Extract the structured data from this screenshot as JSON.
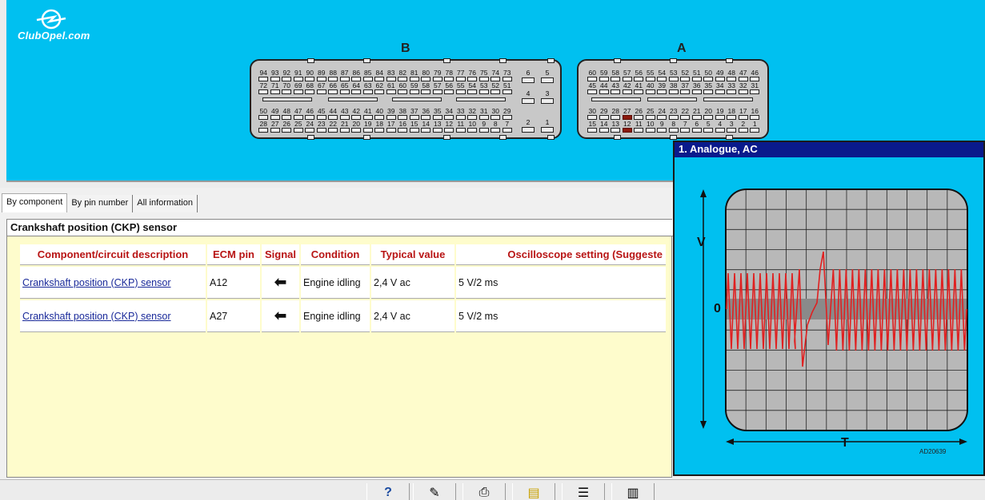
{
  "brand": {
    "logo_text": "ClubOpel.com"
  },
  "connectors": {
    "b": {
      "label": "B",
      "rows": [
        [
          "94",
          "93",
          "92",
          "91",
          "90",
          "89",
          "88",
          "87",
          "86",
          "85",
          "84",
          "83",
          "82",
          "81",
          "80",
          "79",
          "78",
          "77",
          "76",
          "75",
          "74",
          "73"
        ],
        [
          "72",
          "71",
          "70",
          "69",
          "68",
          "67",
          "66",
          "65",
          "64",
          "63",
          "62",
          "61",
          "60",
          "59",
          "58",
          "57",
          "56",
          "55",
          "54",
          "53",
          "52",
          "51"
        ],
        [
          "50",
          "49",
          "48",
          "47",
          "46",
          "45",
          "44",
          "43",
          "42",
          "41",
          "40",
          "39",
          "38",
          "37",
          "36",
          "35",
          "34",
          "33",
          "32",
          "31",
          "30",
          "29"
        ],
        [
          "28",
          "27",
          "26",
          "25",
          "24",
          "23",
          "22",
          "21",
          "20",
          "19",
          "18",
          "17",
          "16",
          "15",
          "14",
          "13",
          "12",
          "11",
          "10",
          "9",
          "8",
          "7"
        ]
      ],
      "side_pins": [
        "6",
        "5",
        "4",
        "3",
        "2",
        "1"
      ]
    },
    "a": {
      "label": "A",
      "rows": [
        [
          "60",
          "59",
          "58",
          "57",
          "56",
          "55",
          "54",
          "53",
          "52",
          "51",
          "50",
          "49",
          "48",
          "47",
          "46"
        ],
        [
          "45",
          "44",
          "43",
          "42",
          "41",
          "40",
          "39",
          "38",
          "37",
          "36",
          "35",
          "34",
          "33",
          "32",
          "31"
        ],
        [
          "30",
          "29",
          "28",
          "27",
          "26",
          "25",
          "24",
          "23",
          "22",
          "21",
          "20",
          "19",
          "18",
          "17",
          "16"
        ],
        [
          "15",
          "14",
          "13",
          "12",
          "11",
          "10",
          "9",
          "8",
          "7",
          "6",
          "5",
          "4",
          "3",
          "2",
          "1"
        ]
      ],
      "highlighted_pins": [
        "27",
        "12"
      ]
    }
  },
  "tabs": [
    "By component",
    "By pin number",
    "All information"
  ],
  "component": {
    "title": "Crankshaft position (CKP) sensor",
    "headers": [
      "Component/circuit description",
      "ECM pin",
      "Signal",
      "Condition",
      "Typical value",
      "Oscilloscope setting (Suggeste"
    ],
    "rows": [
      {
        "description": "Crankshaft position (CKP) sensor",
        "pin": "A12",
        "signal": "🡐",
        "condition": "Engine idling",
        "value": "2,4 V ac",
        "scope": "5 V/2 ms"
      },
      {
        "description": "Crankshaft position (CKP) sensor",
        "pin": "A27",
        "signal": "🡐",
        "condition": "Engine idling",
        "value": "2,4 V ac",
        "scope": "5 V/2 ms"
      }
    ]
  },
  "scope": {
    "title": "1. Analogue, AC",
    "y_label": "V",
    "zero_label": "0",
    "x_label": "T",
    "ref": "AD20639",
    "trace_color": "#e02020"
  },
  "toolbar": {
    "icons": [
      "help-icon",
      "edit-icon",
      "print-icon",
      "folder-icon",
      "notes-icon",
      "book-icon"
    ]
  }
}
